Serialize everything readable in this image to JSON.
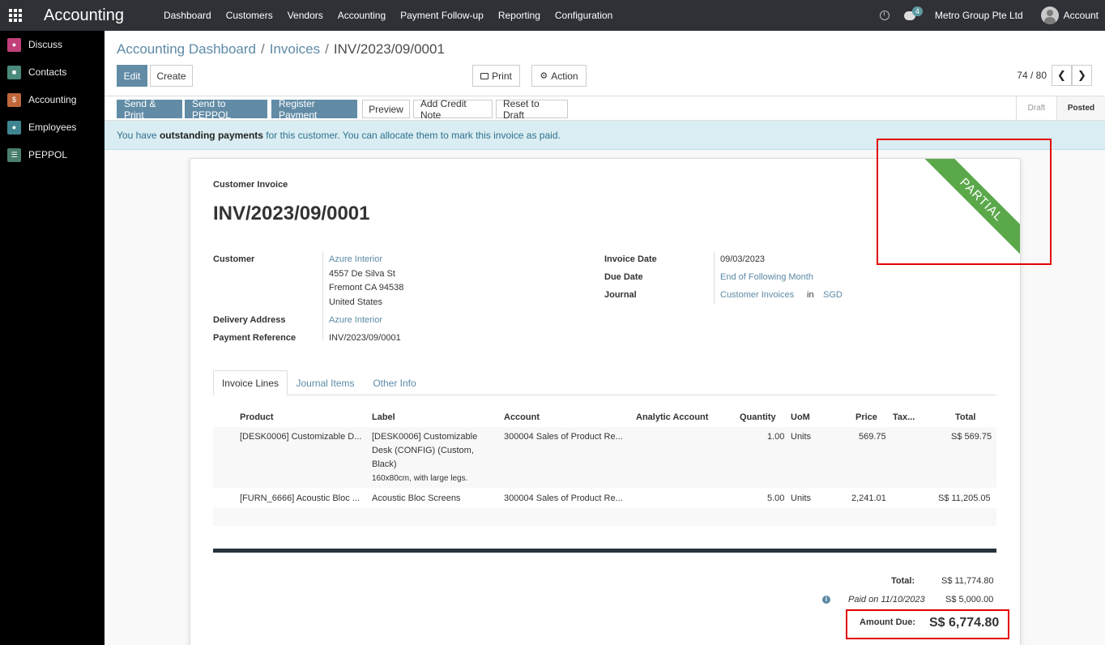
{
  "navbar": {
    "app_title": "Accounting",
    "menu": [
      "Dashboard",
      "Customers",
      "Vendors",
      "Accounting",
      "Payment Follow-up",
      "Reporting",
      "Configuration"
    ],
    "chat_count": "4",
    "company": "Metro Group Pte Ltd",
    "account": "Account"
  },
  "sidebar": {
    "items": [
      {
        "label": "Discuss",
        "color": "#c2407a"
      },
      {
        "label": "Contacts",
        "color": "#4a8a7c"
      },
      {
        "label": "Accounting",
        "color": "#c0663a"
      },
      {
        "label": "Employees",
        "color": "#3f8591"
      },
      {
        "label": "PEPPOL",
        "color": "#4a7f6e"
      }
    ]
  },
  "breadcrumb": {
    "level1": "Accounting Dashboard",
    "level2": "Invoices",
    "current": "INV/2023/09/0001",
    "sep": "/"
  },
  "control": {
    "edit": "Edit",
    "create": "Create",
    "print": "Print",
    "action": "Action",
    "pager": "74 / 80"
  },
  "statusbar": {
    "buttons": [
      "Send & Print",
      "Send to PEPPOL",
      "Register Payment",
      "Preview",
      "Add Credit Note",
      "Reset to Draft"
    ],
    "stages": [
      "Draft",
      "Posted"
    ]
  },
  "alert": {
    "prefix": "You have ",
    "bold": "outstanding payments",
    "suffix": " for this customer. You can allocate them to mark this invoice as paid."
  },
  "invoice": {
    "ribbon": "PARTIAL",
    "type": "Customer Invoice",
    "number": "INV/2023/09/0001",
    "customer_label": "Customer",
    "customer_name": "Azure Interior",
    "customer_addr": [
      "4557 De Silva St",
      "Fremont CA 94538",
      "United States"
    ],
    "delivery_label": "Delivery Address",
    "delivery_value": "Azure Interior",
    "payref_label": "Payment Reference",
    "payref_value": "INV/2023/09/0001",
    "invdate_label": "Invoice Date",
    "invdate_value": "09/03/2023",
    "duedate_label": "Due Date",
    "duedate_value": "End of Following Month",
    "journal_label": "Journal",
    "journal_value": "Customer Invoices",
    "journal_in": "in",
    "journal_currency": "SGD"
  },
  "tabs": [
    "Invoice Lines",
    "Journal Items",
    "Other Info"
  ],
  "lines": {
    "headers": [
      "Product",
      "Label",
      "Account",
      "Analytic Account",
      "Quantity",
      "UoM",
      "Price",
      "Tax...",
      "Total"
    ],
    "rows": [
      {
        "product": "[DESK0006] Customizable D...",
        "label": [
          "[DESK0006] Customizable",
          "Desk (CONFIG) (Custom,",
          "Black)"
        ],
        "label_note": "160x80cm, with large legs.",
        "account": "300004 Sales of Product Re...",
        "qty": "1.00",
        "uom": "Units",
        "price": "569.75",
        "total": "S$ 569.75"
      },
      {
        "product": "[FURN_6666] Acoustic Bloc ...",
        "label": [
          "Acoustic Bloc Screens"
        ],
        "label_note": "",
        "account": "300004 Sales of Product Re...",
        "qty": "5.00",
        "uom": "Units",
        "price": "2,241.01",
        "total": "S$ 11,205.05"
      }
    ]
  },
  "totals": {
    "total_label": "Total:",
    "total_value": "S$ 11,774.80",
    "paid_label": "Paid on 11/10/2023",
    "paid_value": "S$ 5,000.00",
    "due_label": "Amount Due:",
    "due_value": "S$ 6,774.80"
  }
}
